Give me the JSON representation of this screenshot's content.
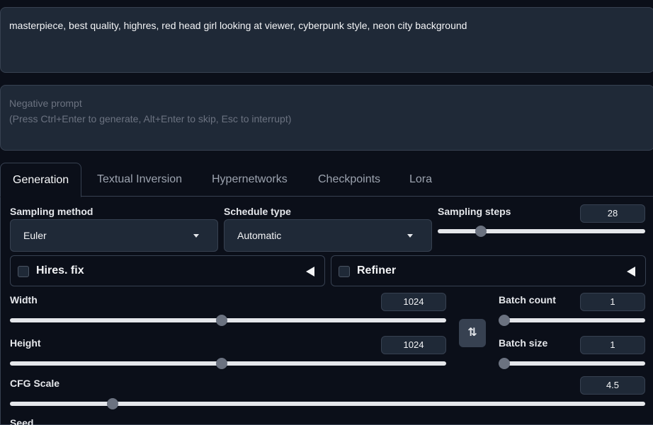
{
  "prompt": {
    "value": "masterpiece, best quality, highres, red head girl looking at viewer, cyberpunk style, neon city background"
  },
  "negative_prompt": {
    "placeholder_line1": "Negative prompt",
    "placeholder_line2": "(Press Ctrl+Enter to generate, Alt+Enter to skip, Esc to interrupt)"
  },
  "tabs": [
    {
      "label": "Generation",
      "active": true
    },
    {
      "label": "Textual Inversion"
    },
    {
      "label": "Hypernetworks"
    },
    {
      "label": "Checkpoints"
    },
    {
      "label": "Lora"
    }
  ],
  "sampling_method": {
    "label": "Sampling method",
    "value": "Euler"
  },
  "schedule_type": {
    "label": "Schedule type",
    "value": "Automatic"
  },
  "sampling_steps": {
    "label": "Sampling steps",
    "value": "28",
    "fraction": 0.19
  },
  "hires_fix": {
    "label": "Hires. fix"
  },
  "refiner": {
    "label": "Refiner"
  },
  "width": {
    "label": "Width",
    "value": "1024",
    "fraction": 0.485
  },
  "height": {
    "label": "Height",
    "value": "1024",
    "fraction": 0.485
  },
  "batch_count": {
    "label": "Batch count",
    "value": "1",
    "fraction": 0.0
  },
  "batch_size": {
    "label": "Batch size",
    "value": "1",
    "fraction": 0.0
  },
  "cfg_scale": {
    "label": "CFG Scale",
    "value": "4.5",
    "fraction": 0.155
  },
  "seed": {
    "label": "Seed"
  },
  "swap_button": {
    "icon": "swap-vertical-icon",
    "glyph": "⇅"
  }
}
